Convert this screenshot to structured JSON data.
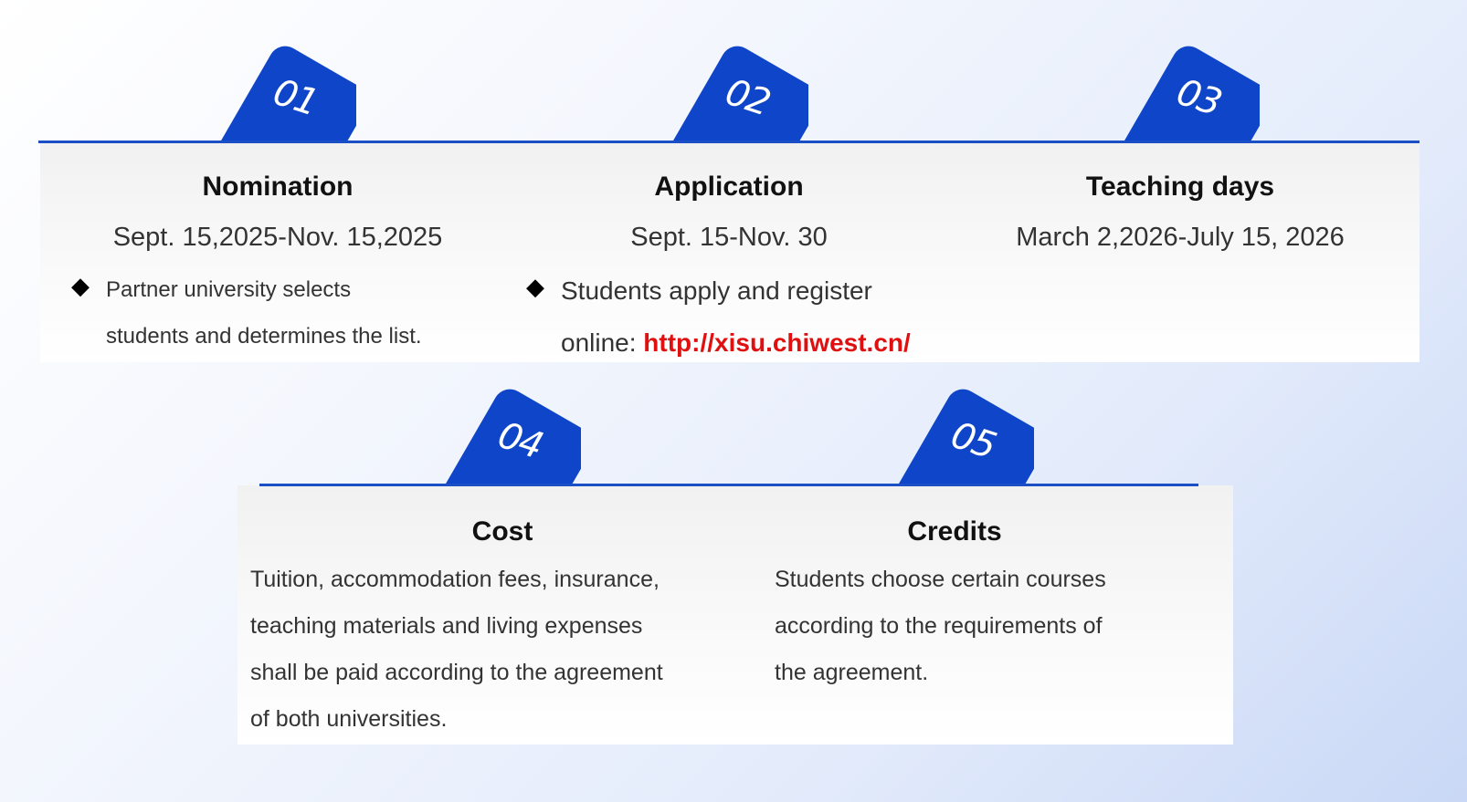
{
  "steps_row1": [
    {
      "number": "01",
      "title": "Nomination",
      "date": "Sept. 15,2025-Nov. 15,2025",
      "bullet_line1": "Partner university selects",
      "bullet_line2": "students and determines the list."
    },
    {
      "number": "02",
      "title": "Application",
      "date": "Sept. 15-Nov. 30",
      "bullet_line1": "Students apply and register",
      "bullet_line2_prefix": "online: ",
      "bullet_link": "http://xisu.chiwest.cn/"
    },
    {
      "number": "03",
      "title": "Teaching days",
      "date": "March 2,2026-July 15, 2026"
    }
  ],
  "steps_row2": [
    {
      "number": "04",
      "title": "Cost",
      "lines": [
        "Tuition, accommodation fees, insurance,",
        "teaching materials and living expenses",
        "shall be paid according to the agreement",
        "of both universities."
      ]
    },
    {
      "number": "05",
      "title": "Credits",
      "lines": [
        "Students choose certain courses",
        "according to the requirements of",
        "the agreement."
      ]
    }
  ],
  "bullet_glyph": "◆",
  "colors": {
    "accent": "#0f45c8",
    "rule": "#1b4fc6",
    "link": "#e01010"
  }
}
